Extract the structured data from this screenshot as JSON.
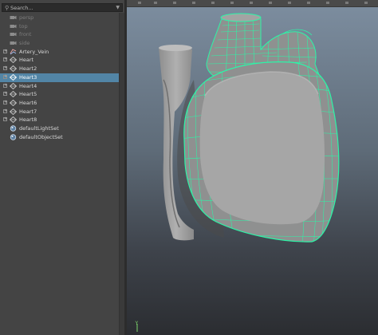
{
  "outliner": {
    "search_placeholder": "Search...",
    "items": [
      {
        "label": "persp",
        "kind": "camera",
        "selected": false,
        "expandable": false
      },
      {
        "label": "top",
        "kind": "camera",
        "selected": false,
        "expandable": false
      },
      {
        "label": "front",
        "kind": "camera",
        "selected": false,
        "expandable": false
      },
      {
        "label": "side",
        "kind": "camera",
        "selected": false,
        "expandable": false
      },
      {
        "label": "Artery_Vein",
        "kind": "mesh-group",
        "selected": false,
        "expandable": true
      },
      {
        "label": "Heart",
        "kind": "mesh",
        "selected": false,
        "expandable": true
      },
      {
        "label": "Heart2",
        "kind": "mesh",
        "selected": false,
        "expandable": true
      },
      {
        "label": "Heart3",
        "kind": "mesh",
        "selected": true,
        "expandable": true
      },
      {
        "label": "Heart4",
        "kind": "mesh",
        "selected": false,
        "expandable": true
      },
      {
        "label": "Heart5",
        "kind": "mesh",
        "selected": false,
        "expandable": true
      },
      {
        "label": "Heart6",
        "kind": "mesh",
        "selected": false,
        "expandable": true
      },
      {
        "label": "Heart7",
        "kind": "mesh",
        "selected": false,
        "expandable": true
      },
      {
        "label": "Heart8",
        "kind": "mesh",
        "selected": false,
        "expandable": true
      },
      {
        "label": "defaultLightSet",
        "kind": "set",
        "selected": false,
        "expandable": false
      },
      {
        "label": "defaultObjectSet",
        "kind": "set",
        "selected": false,
        "expandable": false
      }
    ]
  },
  "viewport": {
    "axis_label": "Y",
    "colors": {
      "background_top": "#7d8ea0",
      "background_bottom": "#2b2d31",
      "wireframe": "#2cf5a7",
      "mesh": "#a8a8a8",
      "selection": "#5285a6"
    },
    "icons": [
      "search-icon",
      "dropdown-arrow-icon",
      "camera-icon",
      "mesh-icon",
      "set-icon",
      "axis-gizmo-icon"
    ]
  }
}
